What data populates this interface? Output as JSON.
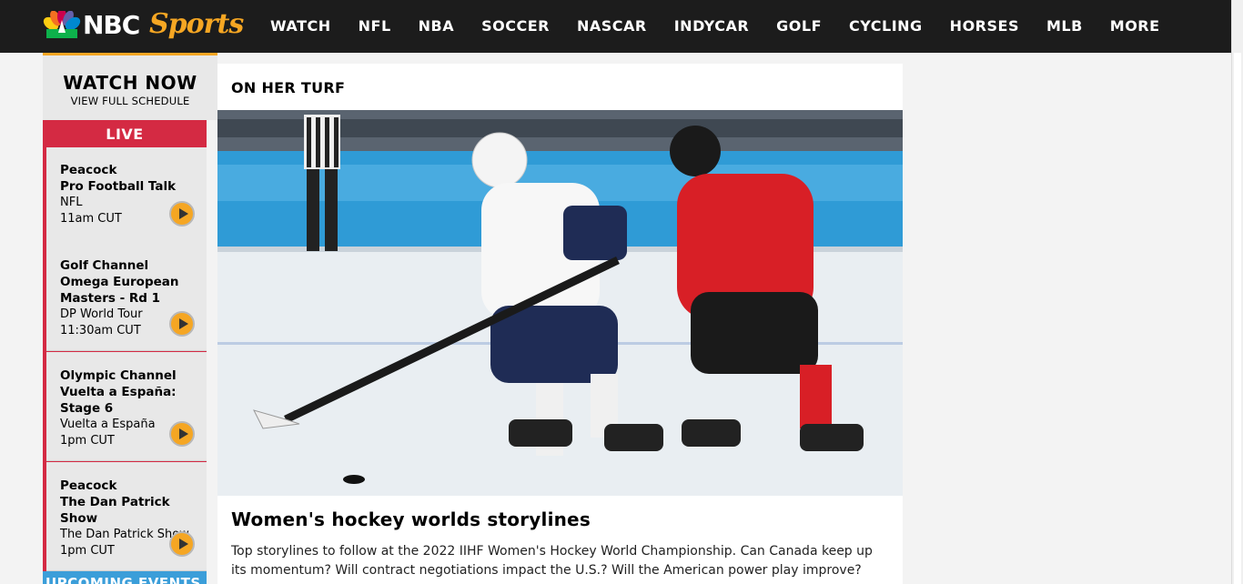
{
  "brand": {
    "logo_text_1": "NBC",
    "logo_text_2": "Sports"
  },
  "nav": {
    "items": [
      "WATCH",
      "NFL",
      "NBA",
      "SOCCER",
      "NASCAR",
      "INDYCAR",
      "GOLF",
      "CYCLING",
      "HORSES",
      "MLB",
      "MORE"
    ]
  },
  "sidebar": {
    "watch_now_title": "WATCH NOW",
    "watch_now_link": "VIEW FULL SCHEDULE",
    "live_label": "LIVE",
    "events": [
      {
        "network": "Peacock",
        "name": "Pro Football Talk",
        "league": "NFL",
        "time": "11am CUT"
      },
      {
        "network": "Golf Channel",
        "name": "Omega European Masters - Rd 1",
        "league": "DP World Tour",
        "time": "11:30am CUT"
      },
      {
        "network": "Olympic Channel",
        "name": "Vuelta a España: Stage 6",
        "league": "Vuelta a España",
        "time": "1pm CUT"
      },
      {
        "network": "Peacock",
        "name": "The Dan Patrick Show",
        "league": "The Dan Patrick Show",
        "time": "1pm CUT"
      }
    ],
    "upcoming_label": "UPCOMING EVENTS"
  },
  "article": {
    "section": "ON HER TURF",
    "headline": "Women's hockey worlds storylines",
    "summary": "Top storylines to follow at the 2022 IIHF Women's Hockey World Championship. Can Canada keep up its momentum? Will contract negotiations impact the U.S.? Will the American power play improve?",
    "image_alt": "hockey-players-photo"
  },
  "colors": {
    "nav_bg": "#1c1c1c",
    "accent_orange": "#f5a623",
    "live_red": "#d42a43",
    "upcoming_blue": "#3b9ed9"
  }
}
